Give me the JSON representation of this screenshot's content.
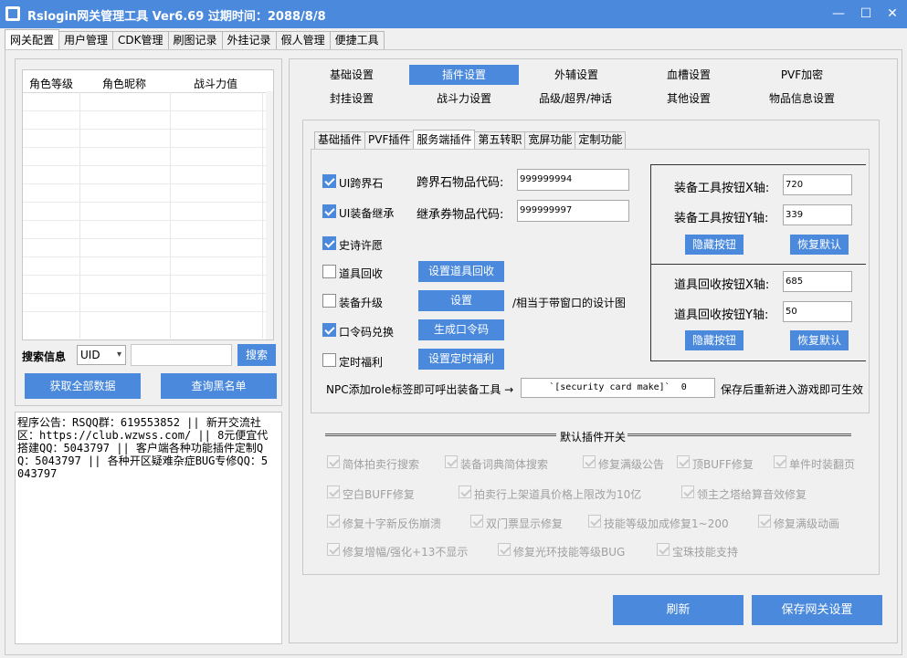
{
  "window": {
    "title": "Rslogin网关管理工具  Ver6.69  过期时间：2088/8/8",
    "minimize": "—",
    "maximize": "☐",
    "close": "✕"
  },
  "main_tabs": [
    {
      "label": "网关配置",
      "active": true
    },
    {
      "label": "用户管理"
    },
    {
      "label": "CDK管理"
    },
    {
      "label": "刷图记录"
    },
    {
      "label": "外挂记录"
    },
    {
      "label": "假人管理"
    },
    {
      "label": "便捷工具"
    }
  ],
  "left": {
    "columns": [
      "角色等级",
      "角色昵称",
      "战斗力值"
    ],
    "search_label": "搜索信息",
    "search_type": "UID",
    "search_value": "",
    "search_button": "搜索",
    "fetch_all_button": "获取全部数据",
    "blacklist_button": "查询黑名单",
    "notice": "程序公告：RSQQ群：619553852 || 新开交流社区：https://club.wzwss.com/ || 8元便宜代搭建QQ：5043797 || 客户端各种功能插件定制QQ：5043797 || 各种开区疑难杂症BUG专修QQ：5043797"
  },
  "nav": {
    "row1": [
      "基础设置",
      "插件设置",
      "外辅设置",
      "血槽设置",
      "PVF加密"
    ],
    "row2": [
      "封挂设置",
      "战斗力设置",
      "品级/超界/神话",
      "其他设置",
      "物品信息设置"
    ],
    "active": "插件设置"
  },
  "sub_tabs": [
    {
      "label": "基础插件"
    },
    {
      "label": "PVF插件"
    },
    {
      "label": "服务端插件",
      "active": true
    },
    {
      "label": "第五转职"
    },
    {
      "label": "宽屏功能"
    },
    {
      "label": "定制功能"
    }
  ],
  "plugins": {
    "ui_cross_stone": {
      "label": "UI跨界石",
      "checked": true
    },
    "ui_equip_inherit": {
      "label": "UI装备继承",
      "checked": true
    },
    "epic_wish": {
      "label": "史诗许愿",
      "checked": true
    },
    "item_recycle": {
      "label": "道具回收",
      "checked": false
    },
    "equip_upgrade": {
      "label": "装备升级",
      "checked": false
    },
    "code_redeem": {
      "label": "口令码兑换",
      "checked": true
    },
    "timed_welfare": {
      "label": "定时福利",
      "checked": false
    },
    "cross_stone_code_label": "跨界石物品代码:",
    "cross_stone_code": "999999994",
    "inherit_ticket_code_label": "继承券物品代码:",
    "inherit_ticket_code": "999999997",
    "set_recycle_button": "设置道具回收",
    "set_button": "设置",
    "set_hint": "/相当于带窗口的设计图",
    "gen_code_button": "生成口令码",
    "set_timed_button": "设置定时福利"
  },
  "position": {
    "equip_x_label": "装备工具按钮X轴:",
    "equip_x": "720",
    "equip_y_label": "装备工具按钮Y轴:",
    "equip_y": "339",
    "hide_button": "隐藏按钮",
    "reset_button": "恢复默认",
    "recycle_x_label": "道具回收按钮X轴:",
    "recycle_x": "685",
    "recycle_y_label": "道具回收按钮Y轴:",
    "recycle_y": "50"
  },
  "npc": {
    "text": "NPC添加role标签即可呼出装备工具 →",
    "value": "`[security card make]`  0",
    "note": "保存后重新进入游戏即可生效"
  },
  "defaults": {
    "title": "默认插件开关",
    "items": [
      [
        "简体拍卖行搜索",
        "装备词典简体搜索",
        "修复满级公告",
        "顶BUFF修复",
        "单件时装翻页"
      ],
      [
        "空白BUFF修复",
        "拍卖行上架道具价格上限改为10亿",
        "领主之塔给算音效修复"
      ],
      [
        "修复十字新反伤崩溃",
        "双门票显示修复",
        "技能等级加成修复1~200",
        "修复满级动画"
      ],
      [
        "修复增幅/强化+13不显示",
        "修复光环技能等级BUG",
        "宝珠技能支持"
      ]
    ]
  },
  "footer": {
    "refresh_button": "刷新",
    "save_button": "保存网关设置"
  },
  "colors": {
    "accent": "#4a89dc"
  }
}
